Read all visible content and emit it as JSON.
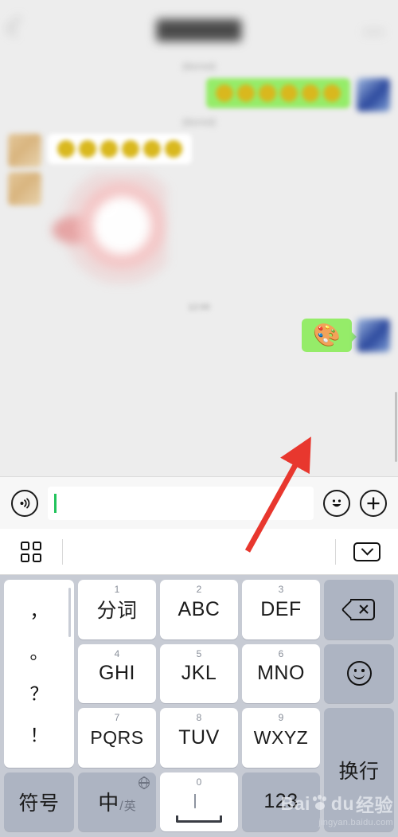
{
  "app": {
    "name": "WeChat chat with Baidu Jingyan tutorial overlay"
  },
  "header": {
    "back_icon": "chevron-left-icon",
    "title": "(blurred)",
    "more_label": "•••"
  },
  "chat": {
    "timestamps": [
      "(blurred)",
      "(blurred)",
      "12:00"
    ],
    "messages": [
      {
        "id": 1,
        "direction": "outgoing",
        "type": "emoji-run",
        "emoji_count": 6,
        "bubble_color": "#95ec69",
        "blurred": true
      },
      {
        "id": 2,
        "direction": "incoming",
        "type": "emoji-run",
        "emoji_count": 6,
        "bubble_color": "#ffffff",
        "blurred": true
      },
      {
        "id": 3,
        "direction": "incoming",
        "type": "sticker",
        "blurred": true
      },
      {
        "id": 4,
        "direction": "outgoing",
        "type": "emoji",
        "emoji": "🎨",
        "emoji_name": "artist-palette",
        "bubble_color": "#95ec69",
        "blurred": false
      }
    ]
  },
  "annotation": {
    "arrow_color": "#e8372e",
    "points_to": "palette-emoji-bubble"
  },
  "input_bar": {
    "voice_icon": "voice-input-icon",
    "field_value": "",
    "field_placeholder": "",
    "caret_color": "#22c35c",
    "emoji_icon": "smiley-face-icon",
    "plus_icon": "plus-circle-icon"
  },
  "keyboard_toolbar": {
    "grid_icon": "keyboard-grid-icon",
    "collapse_icon": "chevron-down-icon"
  },
  "keyboard": {
    "background_color": "#c7cbd4",
    "key_color": "#ffffff",
    "fn_key_color": "#adb4c2",
    "punctuation_key": {
      "name": "punctuation-key",
      "marks": [
        "，",
        "。",
        "？",
        "！"
      ]
    },
    "rows": [
      [
        {
          "num": "1",
          "label": "分词",
          "type": "letter"
        },
        {
          "num": "2",
          "label": "ABC",
          "type": "letter"
        },
        {
          "num": "3",
          "label": "DEF",
          "type": "letter"
        }
      ],
      [
        {
          "num": "4",
          "label": "GHI",
          "type": "letter"
        },
        {
          "num": "5",
          "label": "JKL",
          "type": "letter"
        },
        {
          "num": "6",
          "label": "MNO",
          "type": "letter"
        }
      ],
      [
        {
          "num": "7",
          "label": "PQRS",
          "type": "letter"
        },
        {
          "num": "8",
          "label": "TUV",
          "type": "letter"
        },
        {
          "num": "9",
          "label": "WXYZ",
          "type": "letter"
        }
      ]
    ],
    "bottom_row": {
      "symbols_label": "符号",
      "lang_zh": "中",
      "lang_sep": "/",
      "lang_en": "英",
      "globe_icon": "globe-icon",
      "space_num": "0",
      "space_mic_icon": "microphone-icon",
      "numeric_label": "123"
    },
    "right_column": {
      "backspace_icon": "backspace-icon",
      "emoji_icon": "smiley-face-icon",
      "newline_label": "换行"
    }
  },
  "watermark": {
    "brand": "Bai",
    "brand2": "du",
    "suffix": "经验",
    "url": "jingyan.baidu.com"
  }
}
